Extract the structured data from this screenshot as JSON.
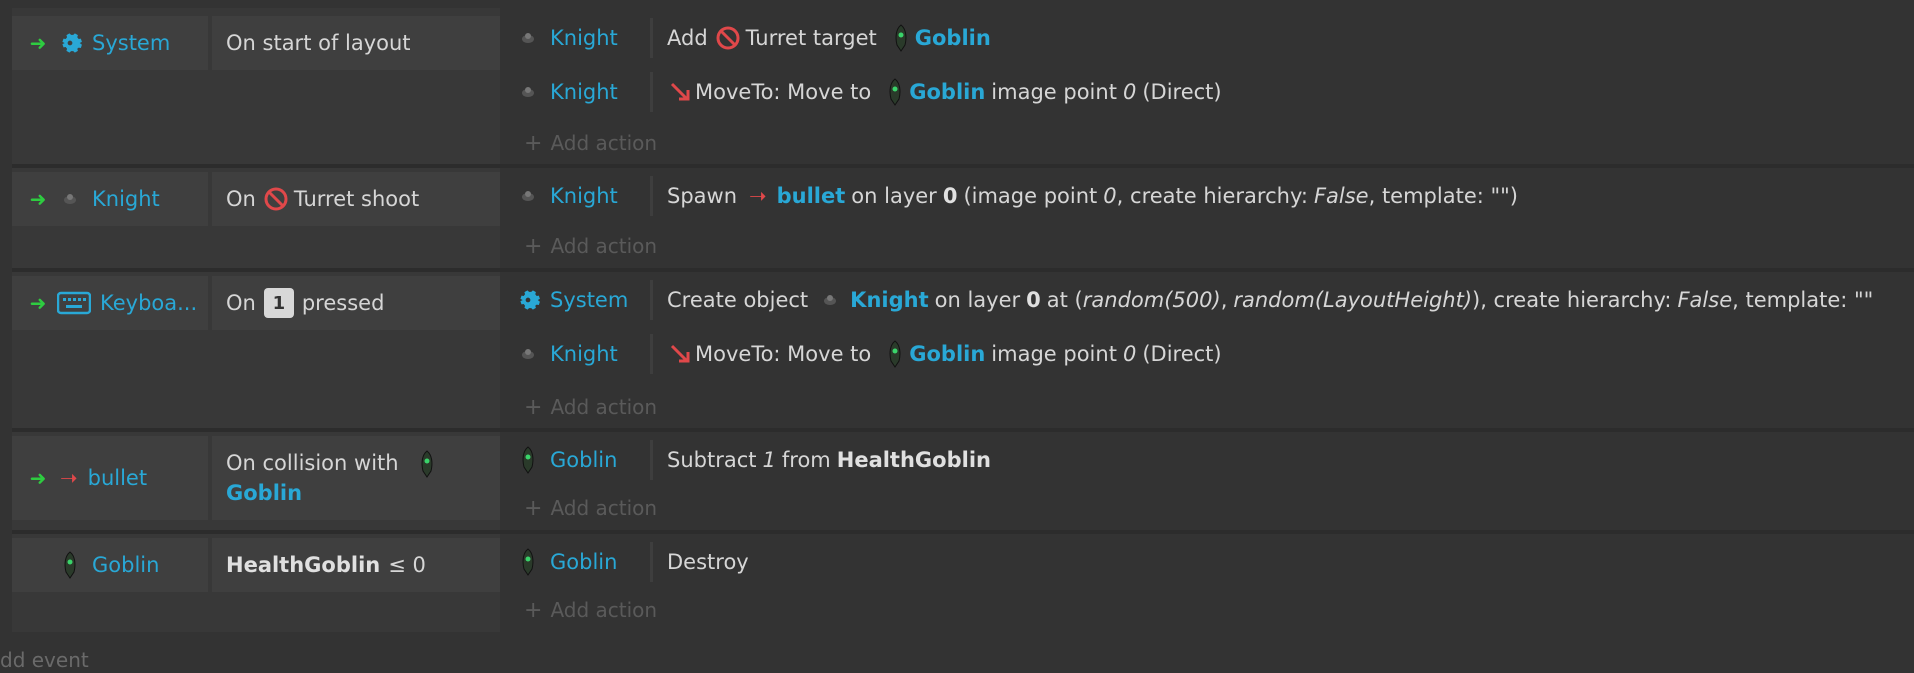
{
  "colors": {
    "object_link": "#29a8d6",
    "trigger_arrow": "#2ecc40",
    "behavior_red": "#e0484a"
  },
  "events": [
    {
      "object": {
        "icon": "gear-icon",
        "label": "System"
      },
      "condition": {
        "text": "On start of layout"
      },
      "actions": [
        {
          "object": {
            "icon": "knight-icon",
            "label": "Knight"
          },
          "parts": {
            "verb": "Add",
            "behavior": "Turret target",
            "target": "Goblin"
          }
        },
        {
          "object": {
            "icon": "knight-icon",
            "label": "Knight"
          },
          "parts": {
            "verb": "MoveTo: Move to",
            "target": "Goblin",
            "suffix1": "image point",
            "point": "0",
            "suffix2": "(Direct)"
          }
        }
      ],
      "add_action": "Add action"
    },
    {
      "object": {
        "icon": "knight-icon",
        "label": "Knight"
      },
      "condition": {
        "prefix": "On",
        "text": "Turret shoot"
      },
      "actions": [
        {
          "object": {
            "icon": "knight-icon",
            "label": "Knight"
          },
          "parts": {
            "verb": "Spawn",
            "target": "bullet",
            "mid": "on layer",
            "layer": "0",
            "a": "(image point",
            "point": "0",
            "b": ", create hierarchy:",
            "bool": "False",
            "c": ", template: \"\")"
          }
        }
      ],
      "add_action": "Add action"
    },
    {
      "object": {
        "icon": "keyboard-icon",
        "label": "Keyboa..."
      },
      "condition": {
        "prefix": "On",
        "key": "1",
        "text": "pressed"
      },
      "actions": [
        {
          "object": {
            "icon": "gear-icon",
            "label": "System"
          },
          "parts": {
            "verb": "Create object",
            "target": "Knight",
            "mid": "on layer",
            "layer": "0",
            "a": "at (",
            "x": "random(500)",
            "comma": ",",
            "y": "random(LayoutHeight)",
            "b": "), create hierarchy:",
            "bool": "False",
            "c": ", template: \"\""
          }
        },
        {
          "object": {
            "icon": "knight-icon",
            "label": "Knight"
          },
          "parts": {
            "verb": "MoveTo: Move to",
            "target": "Goblin",
            "suffix1": "image point",
            "point": "0",
            "suffix2": "(Direct)"
          }
        }
      ],
      "add_action": "Add action"
    },
    {
      "object": {
        "icon": "bullet-icon",
        "label": "bullet"
      },
      "condition": {
        "text": "On collision with",
        "target": "Goblin"
      },
      "actions": [
        {
          "object": {
            "icon": "goblin-icon",
            "label": "Goblin"
          },
          "parts": {
            "verb": "Subtract",
            "amount": "1",
            "mid": "from",
            "var": "HealthGoblin"
          }
        }
      ],
      "add_action": "Add action"
    },
    {
      "object": {
        "icon": "goblin-icon",
        "label": "Goblin"
      },
      "condition": {
        "var": "HealthGoblin",
        "op": "≤ 0"
      },
      "actions": [
        {
          "object": {
            "icon": "goblin-icon",
            "label": "Goblin"
          },
          "parts": {
            "verb": "Destroy"
          }
        }
      ],
      "add_action": "Add action"
    }
  ],
  "add_event": "dd event"
}
